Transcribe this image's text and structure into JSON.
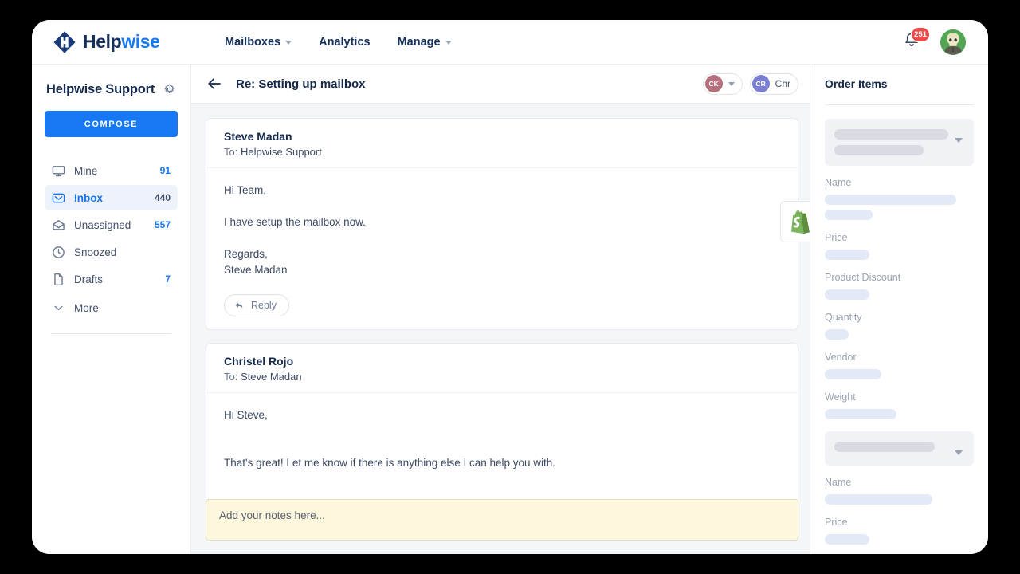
{
  "brand": {
    "name_primary": "Help",
    "name_accent": "wise",
    "logo_icon": "helpwise-diamond-logo",
    "accent_color": "#1877f2",
    "navy_color": "#16315c"
  },
  "topnav": {
    "items": [
      {
        "label": "Mailboxes",
        "has_dropdown": true
      },
      {
        "label": "Analytics",
        "has_dropdown": false
      },
      {
        "label": "Manage",
        "has_dropdown": true
      }
    ],
    "notifications": {
      "icon": "bell-icon",
      "badge_count": "251",
      "badge_color": "#ec4b4b"
    },
    "avatar": {
      "icon": "user-avatar",
      "color": "#53a653"
    }
  },
  "sidebar": {
    "title": "Helpwise Support",
    "settings_icon": "gear-icon",
    "compose_label": "COMPOSE",
    "items": [
      {
        "label": "Mine",
        "count": "91",
        "icon": "monitor-icon",
        "active": false
      },
      {
        "label": "Inbox",
        "count": "440",
        "icon": "inbox-icon",
        "active": true
      },
      {
        "label": "Unassigned",
        "count": "557",
        "icon": "open-envelope-icon",
        "active": false
      },
      {
        "label": "Snoozed",
        "count": "",
        "icon": "clock-icon",
        "active": false
      },
      {
        "label": "Drafts",
        "count": "7",
        "icon": "document-icon",
        "active": false
      }
    ],
    "more_label": "More",
    "more_icon": "chevron-down-icon"
  },
  "conversation": {
    "back_icon": "back-arrow-icon",
    "title": "Re: Setting up mailbox",
    "assignees": [
      {
        "initials": "CK",
        "name": "",
        "color": "#b5707e",
        "has_dropdown": true
      },
      {
        "initials": "CR",
        "name": "Chr",
        "color": "#7b7fd4",
        "has_dropdown": false
      }
    ],
    "integration_badge": {
      "icon": "shopify-icon",
      "color": "#5e8e3e"
    },
    "messages": [
      {
        "from": "Steve Madan",
        "to_label": "To:",
        "to": "Helpwise Support",
        "lines": [
          "Hi Team,",
          "",
          "I have setup the mailbox now.",
          "",
          "Regards,",
          "Steve Madan"
        ],
        "reply_label": "Reply",
        "reply_icon": "reply-arrow-icon",
        "has_reply": true
      },
      {
        "from": "Christel Rojo",
        "to_label": "To:",
        "to": "Steve Madan",
        "lines": [
          "Hi Steve,",
          "",
          "",
          "That's great! Let me know if there is anything else I can help you with."
        ],
        "has_reply": false
      }
    ],
    "notes_placeholder": "Add your notes here...",
    "notes_value": ""
  },
  "right_panel": {
    "title": "Order Items",
    "order_items": [
      {
        "selector_icon": "chevron-down-icon",
        "fields": [
          {
            "label": "Name"
          },
          {
            "label": "Price"
          },
          {
            "label": "Product Discount"
          },
          {
            "label": "Quantity"
          },
          {
            "label": "Vendor"
          },
          {
            "label": "Weight"
          }
        ]
      },
      {
        "selector_icon": "chevron-down-icon",
        "fields": [
          {
            "label": "Name"
          },
          {
            "label": "Price"
          }
        ]
      }
    ]
  }
}
